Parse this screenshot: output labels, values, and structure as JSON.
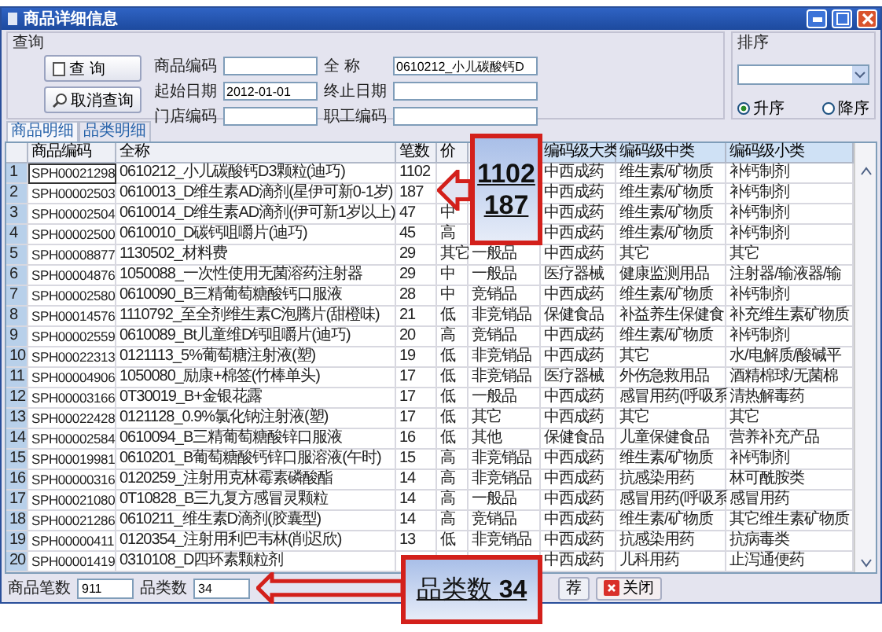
{
  "window": {
    "title": "商品详细信息"
  },
  "query": {
    "title": "查询",
    "buttons": [
      {
        "label": "查 询",
        "kind": "search"
      },
      {
        "label": "取消查询",
        "kind": "cancel"
      }
    ],
    "fields": [
      {
        "label": "商品编码"
      },
      {
        "label": "起始日期",
        "value": "2012-01-01"
      },
      {
        "label": "门店编码"
      },
      {
        "label": "全 称",
        "value": "0610212_小儿碳酸钙D"
      },
      {
        "label": "终止日期"
      },
      {
        "label": "职工编码"
      }
    ]
  },
  "sort": {
    "title": "排序",
    "options": [
      {
        "label": "升序",
        "selected": true
      },
      {
        "label": "降序",
        "selected": false
      }
    ]
  },
  "tabs": [
    {
      "label": "商品明细",
      "selected": true
    },
    {
      "label": "品类明细",
      "selected": false
    }
  ],
  "table": {
    "columns": [
      null,
      "商品编码",
      "全称",
      "笔数",
      "价",
      null,
      "编码级大类",
      "编码级中类",
      "编码级小类"
    ],
    "rows": [
      {
        "selected": true,
        "cells": [
          "1",
          "SPH00021298",
          "0610212_小儿碳酸钙D3颗粒(迪巧)",
          "1102",
          null,
          null,
          "中西成药",
          "维生素/矿物质",
          "补钙制剂"
        ]
      },
      {
        "selected": false,
        "cells": [
          "2",
          "SPH00002503",
          "0610013_D维生素AD滴剂(星伊可新0-1岁)",
          "187",
          null,
          null,
          "中西成药",
          "维生素/矿物质",
          "补钙制剂"
        ]
      },
      {
        "selected": false,
        "cells": [
          "3",
          "SPH00002504",
          "0610014_D维生素AD滴剂(伊可新1岁以上)",
          "47",
          "中",
          null,
          "中西成药",
          "维生素/矿物质",
          "补钙制剂"
        ]
      },
      {
        "selected": false,
        "cells": [
          "4",
          "SPH00002500",
          "0610010_D碳钙咀嚼片(迪巧)",
          "45",
          "高",
          null,
          "中西成药",
          "维生素/矿物质",
          "补钙制剂"
        ]
      },
      {
        "selected": false,
        "cells": [
          "5",
          "SPH00008877",
          "1130502_材料费",
          "29",
          "其它",
          "一般品",
          "中西成药",
          "其它",
          "其它"
        ]
      },
      {
        "selected": false,
        "cells": [
          "6",
          "SPH00004876",
          "1050088_一次性使用无菌溶药注射器",
          "29",
          "中",
          "一般品",
          "医疗器械",
          "健康监测用品",
          "注射器/输液器/输"
        ]
      },
      {
        "selected": false,
        "cells": [
          "7",
          "SPH00002580",
          "0610090_B三精葡萄糖酸钙口服液",
          "28",
          "中",
          "竞销品",
          "中西成药",
          "维生素/矿物质",
          "补钙制剂"
        ]
      },
      {
        "selected": false,
        "cells": [
          "8",
          "SPH00014576",
          "1110792_至全剂维生素C泡腾片(甜橙味)",
          "21",
          "低",
          "非竞销品",
          "保健食品",
          "补益养生保健食",
          "补充维生素矿物质"
        ]
      },
      {
        "selected": false,
        "cells": [
          "9",
          "SPH00002559",
          "0610089_Bt儿童维D钙咀嚼片(迪巧)",
          "20",
          "高",
          "竞销品",
          "中西成药",
          "维生素/矿物质",
          "补钙制剂"
        ]
      },
      {
        "selected": false,
        "cells": [
          "10",
          "SPH00022313",
          "0121113_5%葡萄糖注射液(塑)",
          "19",
          "低",
          "非竞销品",
          "中西成药",
          "其它",
          "水/电解质/酸碱平"
        ]
      },
      {
        "selected": false,
        "cells": [
          "11",
          "SPH00004906",
          "1050080_励康+棉签(竹棒单头)",
          "17",
          "低",
          "非竞销品",
          "医疗器械",
          "外伤急救用品",
          "酒精棉球/无菌棉"
        ]
      },
      {
        "selected": false,
        "cells": [
          "12",
          "SPH00003166",
          "0T30019_B+金银花露",
          "17",
          "低",
          "一般品",
          "中西成药",
          "感冒用药(呼吸系",
          "清热解毒药"
        ]
      },
      {
        "selected": false,
        "cells": [
          "13",
          "SPH00022428",
          "0121128_0.9%氯化钠注射液(塑)",
          "17",
          "低",
          "其它",
          "中西成药",
          "其它",
          "其它"
        ]
      },
      {
        "selected": false,
        "cells": [
          "14",
          "SPH00002584",
          "0610094_B三精葡萄糖酸锌口服液",
          "16",
          "低",
          "其他",
          "保健食品",
          "儿童保健食品",
          "营养补充产品"
        ]
      },
      {
        "selected": false,
        "cells": [
          "15",
          "SPH00019981",
          "0610201_B葡萄糖酸钙锌口服溶液(午时)",
          "15",
          "高",
          "非竞销品",
          "中西成药",
          "维生素/矿物质",
          "补钙制剂"
        ]
      },
      {
        "selected": false,
        "cells": [
          "16",
          "SPH00000316",
          "0120259_注射用克林霉素磷酸酯",
          "14",
          "高",
          "非竞销品",
          "中西成药",
          "抗感染用药",
          "林可酰胺类"
        ]
      },
      {
        "selected": false,
        "cells": [
          "17",
          "SPH00021080",
          "0T10828_B三九复方感冒灵颗粒",
          "14",
          "高",
          "一般品",
          "中西成药",
          "感冒用药(呼吸系",
          "感冒用药"
        ]
      },
      {
        "selected": false,
        "cells": [
          "18",
          "SPH00021286",
          "0610211_维生素D滴剂(胶囊型)",
          "14",
          "高",
          "竞销品",
          "中西成药",
          "维生素/矿物质",
          "其它维生素矿物质"
        ]
      },
      {
        "selected": false,
        "cells": [
          "19",
          "SPH00000411",
          "0120354_注射用利巴韦林(削迟欣)",
          "13",
          "低",
          "非竞销品",
          "中西成药",
          "抗感染用药",
          "抗病毒类"
        ]
      },
      {
        "selected": false,
        "cells": [
          "20",
          "SPH00001419",
          "0310108_D四环素颗粒剂",
          null,
          null,
          null,
          "中西成药",
          "儿科用药",
          "止泻通便药"
        ]
      }
    ]
  },
  "footer": {
    "fields": [
      {
        "label": "商品笔数",
        "value": "911"
      },
      {
        "label": "品类数",
        "value": "34"
      }
    ],
    "buttons": [
      {
        "label": "荐",
        "kind": "plain"
      },
      {
        "label": "关闭",
        "kind": "close"
      }
    ]
  },
  "callouts": [
    {
      "lines": [
        "1102",
        "187"
      ]
    },
    {
      "lines": [
        "品类数 **34**"
      ]
    }
  ]
}
